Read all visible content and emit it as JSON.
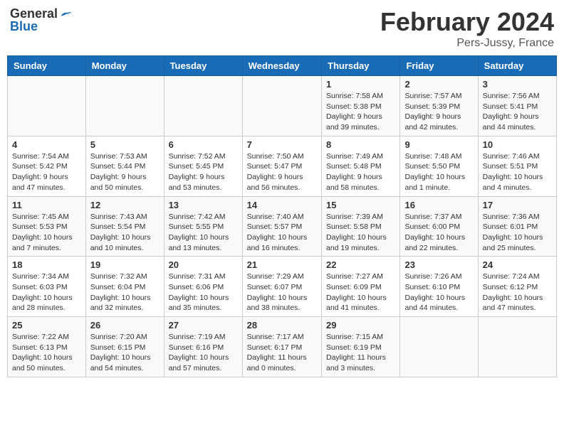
{
  "header": {
    "logo_general": "General",
    "logo_blue": "Blue",
    "month": "February 2024",
    "location": "Pers-Jussy, France"
  },
  "weekdays": [
    "Sunday",
    "Monday",
    "Tuesday",
    "Wednesday",
    "Thursday",
    "Friday",
    "Saturday"
  ],
  "weeks": [
    [
      {
        "day": "",
        "info": ""
      },
      {
        "day": "",
        "info": ""
      },
      {
        "day": "",
        "info": ""
      },
      {
        "day": "",
        "info": ""
      },
      {
        "day": "1",
        "sunrise": "7:58 AM",
        "sunset": "5:38 PM",
        "daylight": "9 hours and 39 minutes."
      },
      {
        "day": "2",
        "sunrise": "7:57 AM",
        "sunset": "5:39 PM",
        "daylight": "9 hours and 42 minutes."
      },
      {
        "day": "3",
        "sunrise": "7:56 AM",
        "sunset": "5:41 PM",
        "daylight": "9 hours and 44 minutes."
      }
    ],
    [
      {
        "day": "4",
        "sunrise": "7:54 AM",
        "sunset": "5:42 PM",
        "daylight": "9 hours and 47 minutes."
      },
      {
        "day": "5",
        "sunrise": "7:53 AM",
        "sunset": "5:44 PM",
        "daylight": "9 hours and 50 minutes."
      },
      {
        "day": "6",
        "sunrise": "7:52 AM",
        "sunset": "5:45 PM",
        "daylight": "9 hours and 53 minutes."
      },
      {
        "day": "7",
        "sunrise": "7:50 AM",
        "sunset": "5:47 PM",
        "daylight": "9 hours and 56 minutes."
      },
      {
        "day": "8",
        "sunrise": "7:49 AM",
        "sunset": "5:48 PM",
        "daylight": "9 hours and 58 minutes."
      },
      {
        "day": "9",
        "sunrise": "7:48 AM",
        "sunset": "5:50 PM",
        "daylight": "10 hours and 1 minute."
      },
      {
        "day": "10",
        "sunrise": "7:46 AM",
        "sunset": "5:51 PM",
        "daylight": "10 hours and 4 minutes."
      }
    ],
    [
      {
        "day": "11",
        "sunrise": "7:45 AM",
        "sunset": "5:53 PM",
        "daylight": "10 hours and 7 minutes."
      },
      {
        "day": "12",
        "sunrise": "7:43 AM",
        "sunset": "5:54 PM",
        "daylight": "10 hours and 10 minutes."
      },
      {
        "day": "13",
        "sunrise": "7:42 AM",
        "sunset": "5:55 PM",
        "daylight": "10 hours and 13 minutes."
      },
      {
        "day": "14",
        "sunrise": "7:40 AM",
        "sunset": "5:57 PM",
        "daylight": "10 hours and 16 minutes."
      },
      {
        "day": "15",
        "sunrise": "7:39 AM",
        "sunset": "5:58 PM",
        "daylight": "10 hours and 19 minutes."
      },
      {
        "day": "16",
        "sunrise": "7:37 AM",
        "sunset": "6:00 PM",
        "daylight": "10 hours and 22 minutes."
      },
      {
        "day": "17",
        "sunrise": "7:36 AM",
        "sunset": "6:01 PM",
        "daylight": "10 hours and 25 minutes."
      }
    ],
    [
      {
        "day": "18",
        "sunrise": "7:34 AM",
        "sunset": "6:03 PM",
        "daylight": "10 hours and 28 minutes."
      },
      {
        "day": "19",
        "sunrise": "7:32 AM",
        "sunset": "6:04 PM",
        "daylight": "10 hours and 32 minutes."
      },
      {
        "day": "20",
        "sunrise": "7:31 AM",
        "sunset": "6:06 PM",
        "daylight": "10 hours and 35 minutes."
      },
      {
        "day": "21",
        "sunrise": "7:29 AM",
        "sunset": "6:07 PM",
        "daylight": "10 hours and 38 minutes."
      },
      {
        "day": "22",
        "sunrise": "7:27 AM",
        "sunset": "6:09 PM",
        "daylight": "10 hours and 41 minutes."
      },
      {
        "day": "23",
        "sunrise": "7:26 AM",
        "sunset": "6:10 PM",
        "daylight": "10 hours and 44 minutes."
      },
      {
        "day": "24",
        "sunrise": "7:24 AM",
        "sunset": "6:12 PM",
        "daylight": "10 hours and 47 minutes."
      }
    ],
    [
      {
        "day": "25",
        "sunrise": "7:22 AM",
        "sunset": "6:13 PM",
        "daylight": "10 hours and 50 minutes."
      },
      {
        "day": "26",
        "sunrise": "7:20 AM",
        "sunset": "6:15 PM",
        "daylight": "10 hours and 54 minutes."
      },
      {
        "day": "27",
        "sunrise": "7:19 AM",
        "sunset": "6:16 PM",
        "daylight": "10 hours and 57 minutes."
      },
      {
        "day": "28",
        "sunrise": "7:17 AM",
        "sunset": "6:17 PM",
        "daylight": "11 hours and 0 minutes."
      },
      {
        "day": "29",
        "sunrise": "7:15 AM",
        "sunset": "6:19 PM",
        "daylight": "11 hours and 3 minutes."
      },
      {
        "day": "",
        "info": ""
      },
      {
        "day": "",
        "info": ""
      }
    ]
  ]
}
